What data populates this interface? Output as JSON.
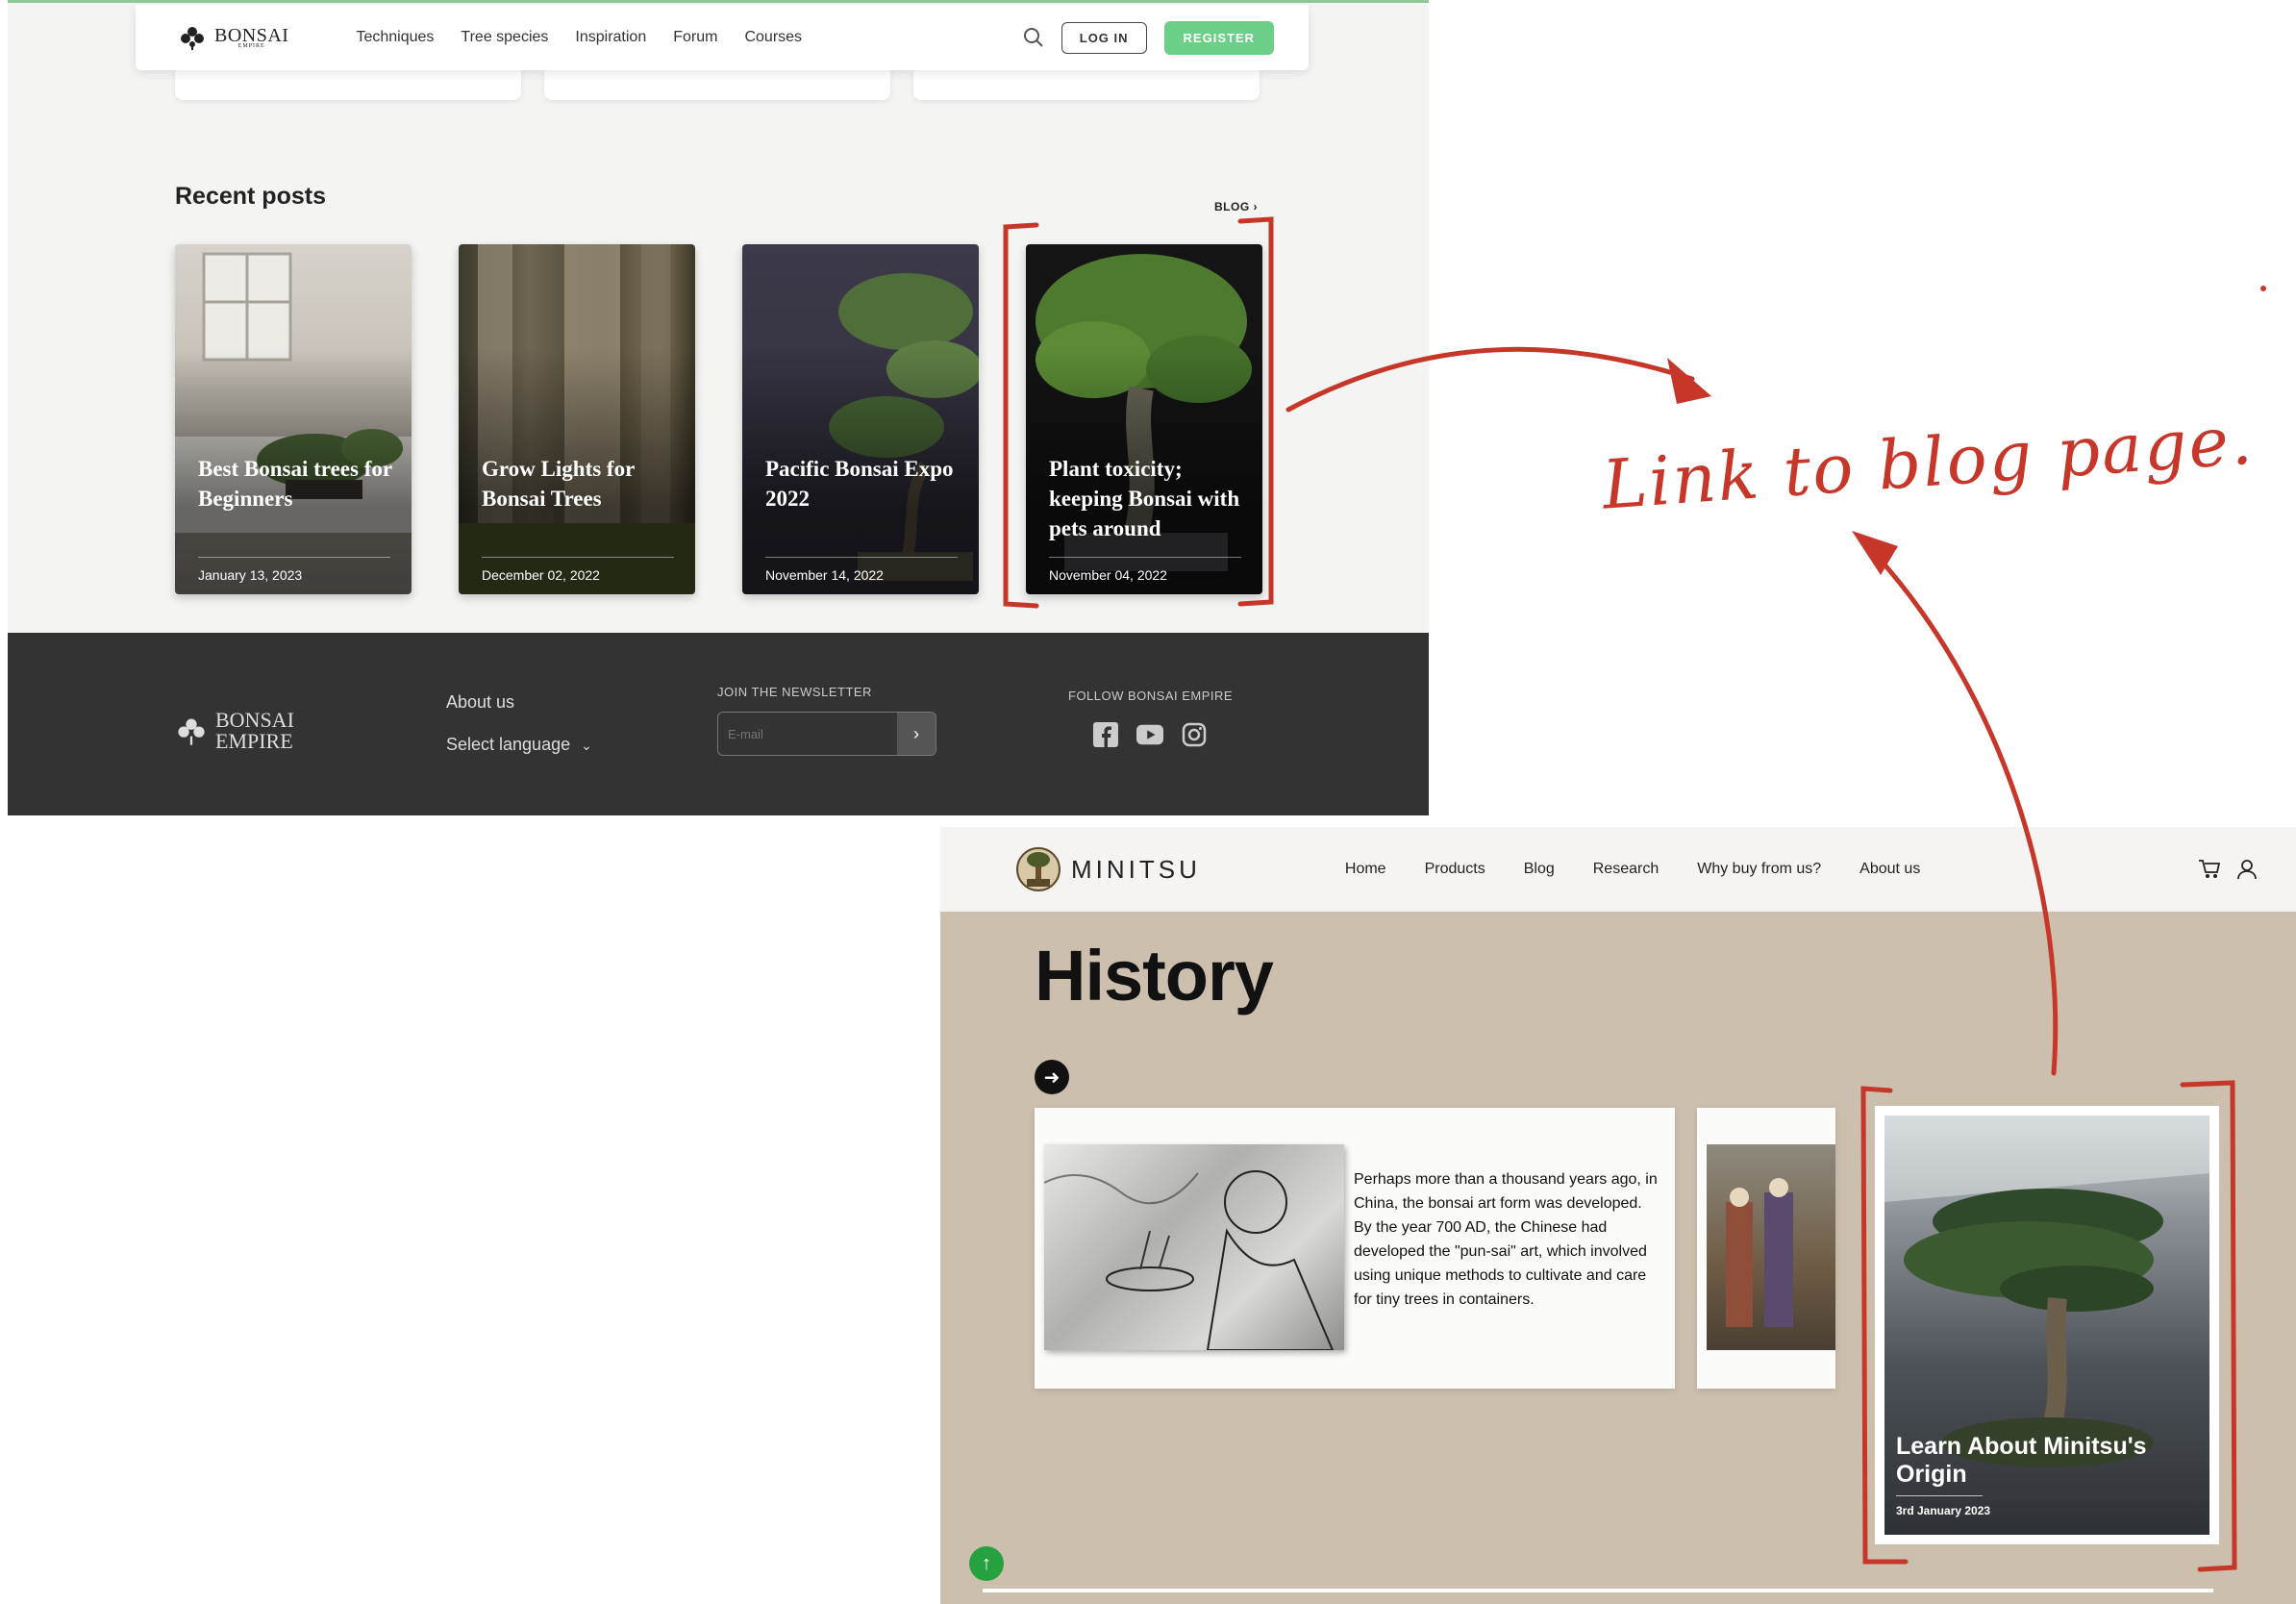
{
  "bonsai": {
    "logo": {
      "name": "BONSAI",
      "sub": "EMPIRE"
    },
    "nav": [
      "Techniques",
      "Tree species",
      "Inspiration",
      "Forum",
      "Courses"
    ],
    "login": "LOG IN",
    "register": "REGISTER",
    "recent_title": "Recent posts",
    "blog_link": "BLOG",
    "posts": [
      {
        "title": "Best Bonsai trees for Beginners",
        "date": "January 13, 2023"
      },
      {
        "title": "Grow Lights for Bonsai Trees",
        "date": "December 02, 2022"
      },
      {
        "title": "Pacific Bonsai Expo 2022",
        "date": "November 14, 2022"
      },
      {
        "title": "Plant toxicity; keeping Bonsai with pets around",
        "date": "November 04, 2022"
      }
    ],
    "footer": {
      "about": "About us",
      "language": "Select language",
      "newsletter_label": "JOIN THE NEWSLETTER",
      "email_placeholder": "E-mail",
      "follow_label": "FOLLOW BONSAI EMPIRE",
      "social_icons": [
        "facebook-icon",
        "youtube-icon",
        "instagram-icon"
      ]
    }
  },
  "minitsu": {
    "logo": "MINITSU",
    "nav": [
      "Home",
      "Products",
      "Blog",
      "Research",
      "Why buy from us?",
      "About us"
    ],
    "title": "History",
    "history_text": "Perhaps more than a thousand years ago, in China, the bonsai art form was developed. By the year 700 AD, the Chinese had developed the \"pun-sai\" art, which involved using unique methods to cultivate and care for tiny trees in containers.",
    "blog_card": {
      "title": "Learn About Minitsu's Origin",
      "date": "3rd January 2023"
    }
  },
  "annotation": {
    "text": "Link to blog page.",
    "color": "#c6372a"
  },
  "colors": {
    "register_green": "#6ccf88",
    "footer_dark": "#333333",
    "minitsu_bg": "#cdbfae",
    "up_button": "#25a140"
  }
}
